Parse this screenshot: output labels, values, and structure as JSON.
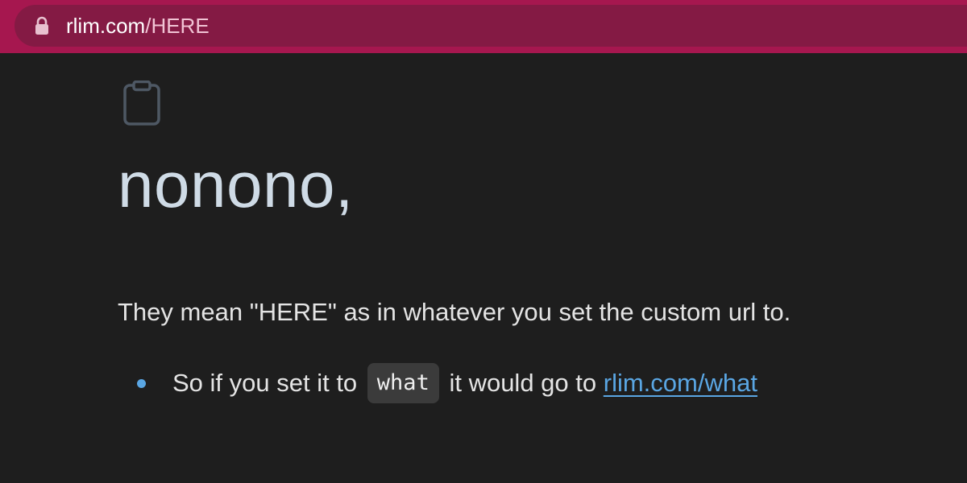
{
  "browser": {
    "url_host": "rlim.com",
    "url_path": "/HERE",
    "theme_color": "#a6174f"
  },
  "page": {
    "icon": "clipboard-icon",
    "heading": "nonono,",
    "paragraph": "They mean \"HERE\" as in whatever you set the custom url to.",
    "bullets": [
      {
        "text_before": "So if you set it to",
        "code": "what",
        "text_middle": "it would go to",
        "link_text": "rlim.com/what"
      }
    ]
  },
  "colors": {
    "background": "#1e1e1e",
    "heading": "#cfdbe6",
    "link": "#5aa6e3"
  }
}
